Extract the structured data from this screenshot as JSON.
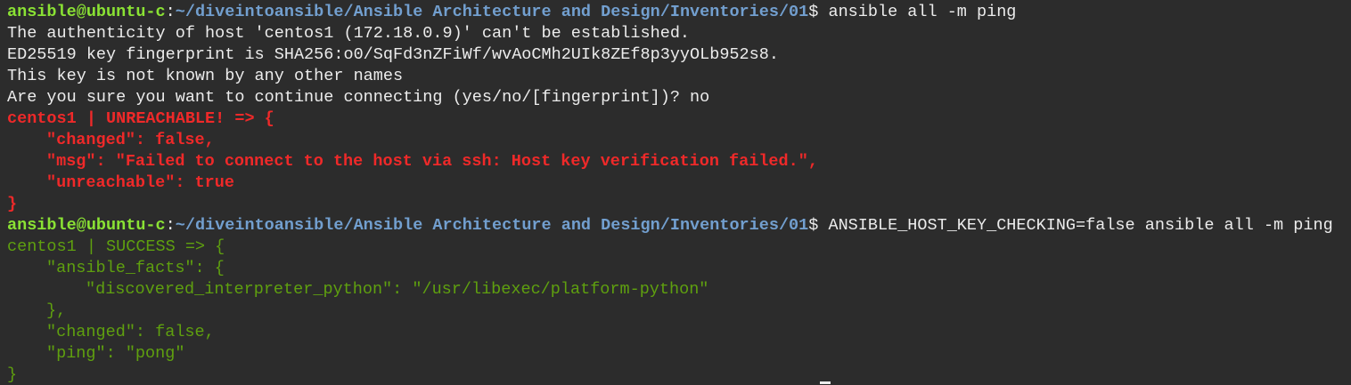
{
  "colors": {
    "background": "#2c2c2c",
    "prompt_user": "#8ae234",
    "prompt_path": "#729fcf",
    "text": "#ececec",
    "error": "#ef2929",
    "success": "#5fa00f"
  },
  "prompt": {
    "user_host": "ansible@ubuntu-c",
    "colon": ":",
    "path": "~/diveintoansible/Ansible Architecture and Design/Inventories/01",
    "symbol": "$"
  },
  "commands": {
    "first": " ansible all -m ping",
    "second": " ANSIBLE_HOST_KEY_CHECKING=false ansible all -m ping"
  },
  "ssh_prompt": {
    "authenticity": "The authenticity of host 'centos1 (172.18.0.9)' can't be established.",
    "fingerprint": "ED25519 key fingerprint is SHA256:o0/SqFd3nZFiWf/wvAoCMh2UIk8ZEf8p3yyOLb952s8.",
    "not_known": "This key is not known by any other names",
    "question": "Are you sure you want to continue connecting (yes/no/[fingerprint])? no"
  },
  "failure": {
    "header": "centos1 | UNREACHABLE! => {",
    "changed": "\"changed\": false,",
    "msg": "\"msg\": \"Failed to connect to the host via ssh: Host key verification failed.\",",
    "unreachable": "\"unreachable\": true",
    "close": "}"
  },
  "success": {
    "header": "centos1 | SUCCESS => {",
    "facts_open": "\"ansible_facts\": {",
    "interpreter": "\"discovered_interpreter_python\": \"/usr/libexec/platform-python\"",
    "facts_close": "},",
    "changed": "\"changed\": false,",
    "ping": "\"ping\": \"pong\"",
    "close": "}"
  }
}
